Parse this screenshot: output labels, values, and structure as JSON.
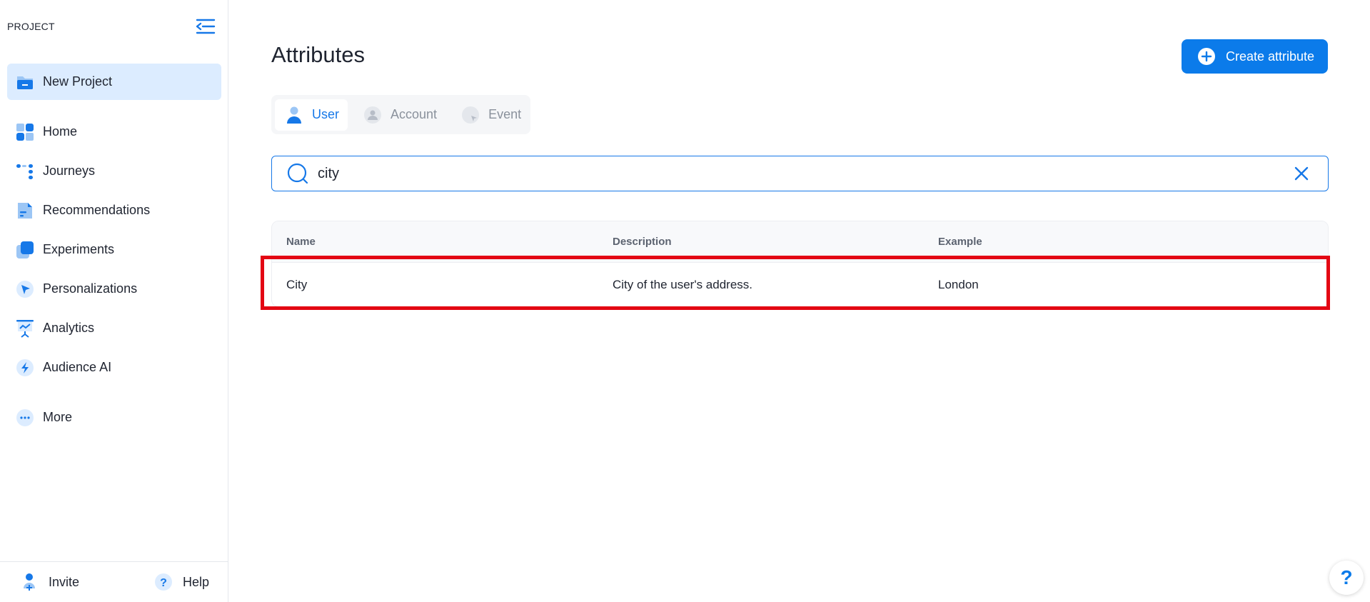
{
  "sidebar": {
    "project_label": "PROJECT",
    "project_name": "New Project",
    "items": [
      {
        "label": "Home",
        "icon": "home-icon"
      },
      {
        "label": "Journeys",
        "icon": "journeys-icon"
      },
      {
        "label": "Recommendations",
        "icon": "recommendations-icon"
      },
      {
        "label": "Experiments",
        "icon": "experiments-icon"
      },
      {
        "label": "Personalizations",
        "icon": "personalizations-icon"
      },
      {
        "label": "Analytics",
        "icon": "analytics-icon"
      },
      {
        "label": "Audience AI",
        "icon": "audience-ai-icon"
      },
      {
        "label": "More",
        "icon": "more-icon"
      }
    ],
    "invite_label": "Invite",
    "help_label": "Help"
  },
  "main": {
    "title": "Attributes",
    "create_button": "Create attribute",
    "tabs": [
      {
        "label": "User",
        "active": true
      },
      {
        "label": "Account",
        "active": false
      },
      {
        "label": "Event",
        "active": false
      }
    ],
    "search": {
      "value": "city",
      "placeholder": ""
    },
    "table": {
      "headers": [
        "Name",
        "Description",
        "Example"
      ],
      "rows": [
        {
          "name": "City",
          "description": "City of the user's address.",
          "example": "London"
        }
      ]
    },
    "float_help": "?"
  },
  "colors": {
    "accent": "#0b7bea",
    "highlight": "#e30613",
    "pill_bg": "#dcecff"
  }
}
